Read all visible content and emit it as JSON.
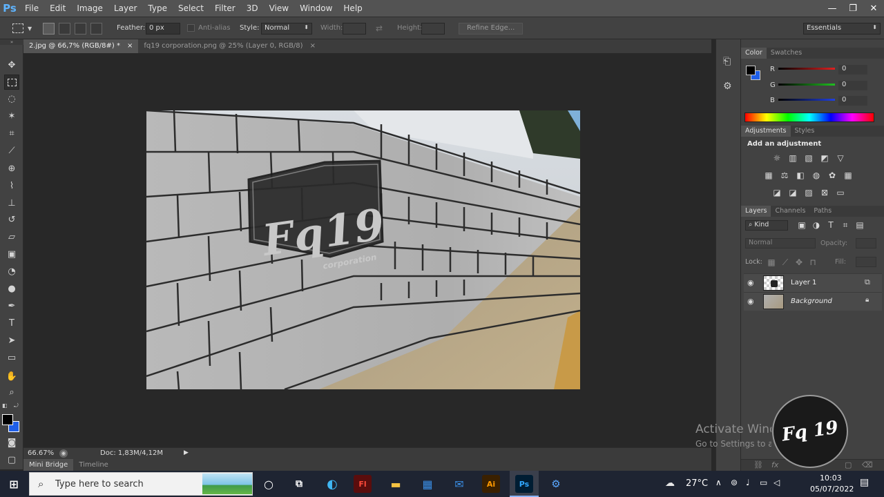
{
  "app": {
    "logo": "Ps"
  },
  "menu": [
    "File",
    "Edit",
    "Image",
    "Layer",
    "Type",
    "Select",
    "Filter",
    "3D",
    "View",
    "Window",
    "Help"
  ],
  "window_controls": {
    "minimize": "—",
    "restore": "❐",
    "close": "✕"
  },
  "options": {
    "feather_label": "Feather:",
    "feather_value": "0 px",
    "antialias_label": "Anti-alias",
    "style_label": "Style:",
    "style_value": "Normal",
    "width_label": "Width:",
    "height_label": "Height:",
    "refine_edge": "Refine Edge...",
    "workspace": "Essentials"
  },
  "tabs": [
    {
      "label": "2.jpg @ 66,7% (RGB/8#) *",
      "close": "×"
    },
    {
      "label": "fq19 corporation.png @ 25% (Layer 0, RGB/8)",
      "close": "×"
    }
  ],
  "artwork": {
    "logo_text": "Fq19",
    "logo_subtext": "corporation"
  },
  "status": {
    "zoom": "66.67%",
    "doc": "Doc: 1,83M/4,12M"
  },
  "bottom_tabs": [
    "Mini Bridge",
    "Timeline"
  ],
  "color_panel": {
    "tabs": [
      "Color",
      "Swatches"
    ],
    "channels": [
      {
        "label": "R",
        "value": "0",
        "color": "#e02020"
      },
      {
        "label": "G",
        "value": "0",
        "color": "#20c020"
      },
      {
        "label": "B",
        "value": "0",
        "color": "#2040e0"
      }
    ]
  },
  "adjustments": {
    "tabs": [
      "Adjustments",
      "Styles"
    ],
    "title": "Add an adjustment"
  },
  "layers_panel": {
    "tabs": [
      "Layers",
      "Channels",
      "Paths"
    ],
    "filter_kind": "Kind",
    "blend_mode": "Normal",
    "opacity_label": "Opacity:",
    "lock_label": "Lock:",
    "fill_label": "Fill:",
    "layers": [
      {
        "name": "Layer 1"
      },
      {
        "name": "Background"
      }
    ]
  },
  "watermark": {
    "line1": "Activate Windows",
    "line2": "Go to Settings to activate Windows.",
    "logo": "Fq 19"
  },
  "taskbar": {
    "search_placeholder": "Type here to search",
    "temperature": "27°C",
    "time": "10:03",
    "date": "05/07/2022"
  },
  "colors": {
    "accent": "#5fb4ff",
    "foreground_color": "#000000",
    "background_color": "#1f5fe8"
  }
}
